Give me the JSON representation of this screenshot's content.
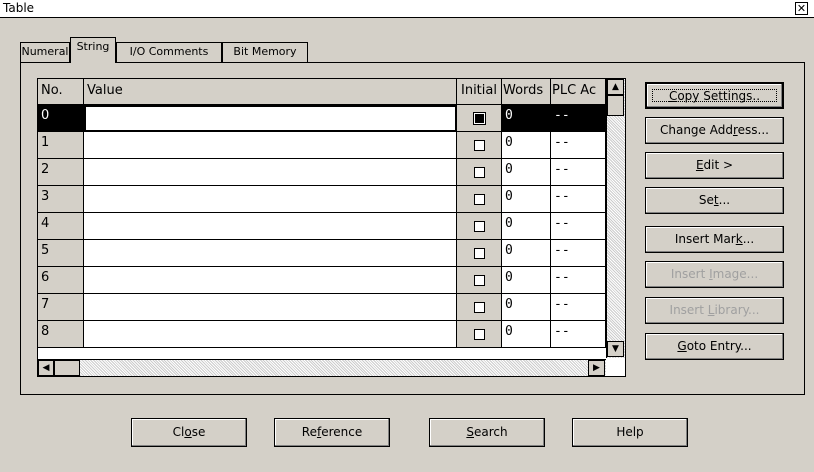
{
  "window": {
    "title": "Table",
    "close_glyph": "✕"
  },
  "tabs": [
    {
      "label": "Numeral",
      "active": false
    },
    {
      "label": "String",
      "active": true
    },
    {
      "label": "I/O Comments",
      "active": false
    },
    {
      "label": "Bit Memory",
      "active": false
    }
  ],
  "table": {
    "headers": {
      "no": "No.",
      "value": "Value",
      "initial": "Initial",
      "words": "Words",
      "plc": "PLC Ac"
    },
    "rows": [
      {
        "no": "0",
        "value": "",
        "initial": true,
        "words": "0",
        "plc": "--"
      },
      {
        "no": "1",
        "value": "",
        "initial": false,
        "words": "0",
        "plc": "--"
      },
      {
        "no": "2",
        "value": "",
        "initial": false,
        "words": "0",
        "plc": "--"
      },
      {
        "no": "3",
        "value": "",
        "initial": false,
        "words": "0",
        "plc": "--"
      },
      {
        "no": "4",
        "value": "",
        "initial": false,
        "words": "0",
        "plc": "--"
      },
      {
        "no": "5",
        "value": "",
        "initial": false,
        "words": "0",
        "plc": "--"
      },
      {
        "no": "6",
        "value": "",
        "initial": false,
        "words": "0",
        "plc": "--"
      },
      {
        "no": "7",
        "value": "",
        "initial": false,
        "words": "0",
        "plc": "--"
      },
      {
        "no": "8",
        "value": "",
        "initial": false,
        "words": "0",
        "plc": "--"
      }
    ],
    "selected_row": "0"
  },
  "side_buttons": {
    "copy_settings": {
      "pre": "",
      "key": "C",
      "post": "opy Settings..",
      "enabled": true
    },
    "change_address": {
      "pre": "Change Add",
      "key": "r",
      "post": "ess...",
      "enabled": true
    },
    "edit": {
      "pre": "",
      "key": "E",
      "post": "dit >",
      "enabled": true
    },
    "set": {
      "pre": "Se",
      "key": "t",
      "post": "...",
      "enabled": true
    },
    "insert_mark": {
      "pre": "Insert Mar",
      "key": "k",
      "post": "...",
      "enabled": true
    },
    "insert_image": {
      "pre": "Insert ",
      "key": "I",
      "post": "mage...",
      "enabled": false
    },
    "insert_library": {
      "pre": "Insert ",
      "key": "L",
      "post": "ibrary...",
      "enabled": false
    },
    "goto_entry": {
      "pre": "",
      "key": "G",
      "post": "oto Entry...",
      "enabled": true
    }
  },
  "bottom_buttons": {
    "close": {
      "pre": "Cl",
      "key": "o",
      "post": "se"
    },
    "reference": {
      "pre": "Re",
      "key": "f",
      "post": "erence"
    },
    "search": {
      "pre": "",
      "key": "S",
      "post": "earch"
    },
    "help": {
      "pre": "Help",
      "key": "",
      "post": ""
    }
  }
}
